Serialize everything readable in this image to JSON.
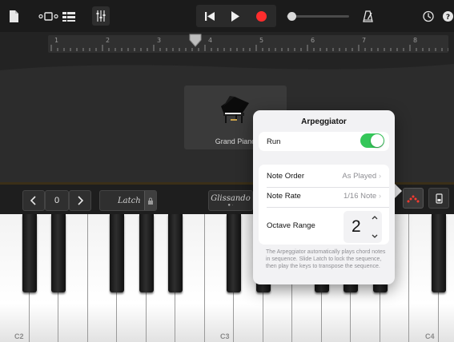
{
  "ruler": {
    "bars": [
      "1",
      "2",
      "3",
      "4",
      "5",
      "6",
      "7",
      "8"
    ]
  },
  "instrument": {
    "name": "Grand Piano"
  },
  "controls": {
    "octave_value": "0",
    "latch_label": "Latch",
    "glissando_label": "Glissando"
  },
  "keyboard": {
    "labels": [
      "C2",
      "C3",
      "C4"
    ]
  },
  "arpeggiator": {
    "title": "Arpeggiator",
    "run_label": "Run",
    "run_on": true,
    "note_order_label": "Note Order",
    "note_order_value": "As Played",
    "note_rate_label": "Note Rate",
    "note_rate_value": "1/16 Note",
    "octave_range_label": "Octave Range",
    "octave_range_value": "2",
    "footnote": "The Arpeggiator automatically plays chord notes in sequence. Slide Latch to lock the sequence, then play the keys to transpose the sequence."
  },
  "colors": {
    "accent_record": "#ff2d2d",
    "toggle_on": "#35c759",
    "arp_icon": "#ff3b30"
  }
}
